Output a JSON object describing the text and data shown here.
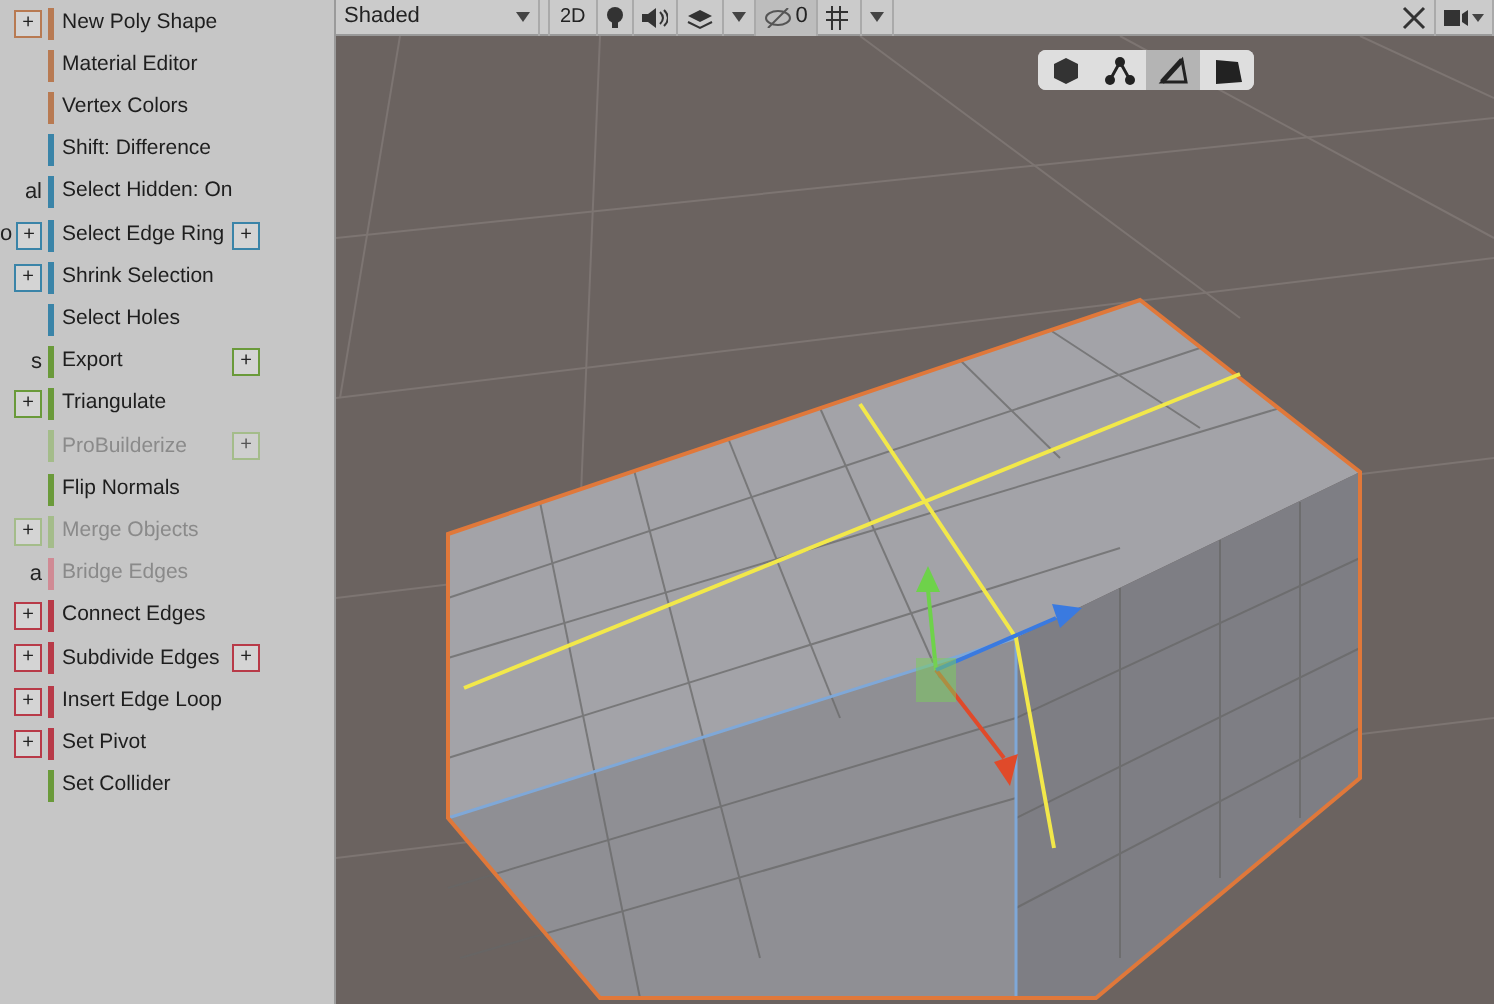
{
  "menu": [
    {
      "left_plus": "+",
      "label": "New Poly Shape",
      "color": "#b87a52",
      "disabled": false
    },
    {
      "label": "Material Editor",
      "color": "#b87a52",
      "disabled": false
    },
    {
      "label": "Vertex Colors",
      "color": "#b87a52",
      "disabled": false
    },
    {
      "label": "Shift: Difference",
      "color": "#3a84a8",
      "disabled": false
    },
    {
      "left_label": "al",
      "label": "Select Hidden: On",
      "color": "#3a84a8",
      "disabled": false
    },
    {
      "left_label": "o",
      "left_plus": "+",
      "label": "Select Edge Ring",
      "color": "#3a84a8",
      "disabled": false,
      "plus": "+"
    },
    {
      "left_plus": "+",
      "label": "Shrink Selection",
      "color": "#3a84a8",
      "disabled": false
    },
    {
      "label": "Select Holes",
      "color": "#3a84a8",
      "disabled": false
    },
    {
      "left_label": "s",
      "label": "Export",
      "color": "#6a9a3a",
      "disabled": false,
      "plus": "+"
    },
    {
      "left_plus": "+",
      "label": "Triangulate",
      "color": "#6a9a3a",
      "disabled": false
    },
    {
      "label": "ProBuilderize",
      "color": "#a4bc8a",
      "disabled": true,
      "plus": "+"
    },
    {
      "label": "Flip Normals",
      "color": "#6a9a3a",
      "disabled": false
    },
    {
      "left_plus": "+",
      "label": "Merge Objects",
      "color": "#a4bc8a",
      "disabled": true
    },
    {
      "left_label": "a",
      "label": "Bridge Edges",
      "color": "#d08a94",
      "disabled": true
    },
    {
      "left_plus": "+",
      "label": "Connect Edges",
      "color": "#b83a48",
      "disabled": false
    },
    {
      "left_plus": "+",
      "label": "Subdivide Edges",
      "color": "#b83a48",
      "disabled": false,
      "plus": "+"
    },
    {
      "left_plus": "+",
      "label": "Insert Edge Loop",
      "color": "#b83a48",
      "disabled": false
    },
    {
      "left_plus": "+",
      "label": "Set Pivot",
      "color": "#b83a48",
      "disabled": false
    },
    {
      "label": "Set Collider",
      "color": "#6a9a3a",
      "disabled": false
    }
  ],
  "toolbar": {
    "shading": "Shaded",
    "mode_2d": "2D",
    "hidden_count": "0"
  },
  "select_modes": [
    {
      "kind": "object",
      "selected": false
    },
    {
      "kind": "vertex",
      "selected": false
    },
    {
      "kind": "edge",
      "selected": true
    },
    {
      "kind": "face",
      "selected": false
    }
  ]
}
